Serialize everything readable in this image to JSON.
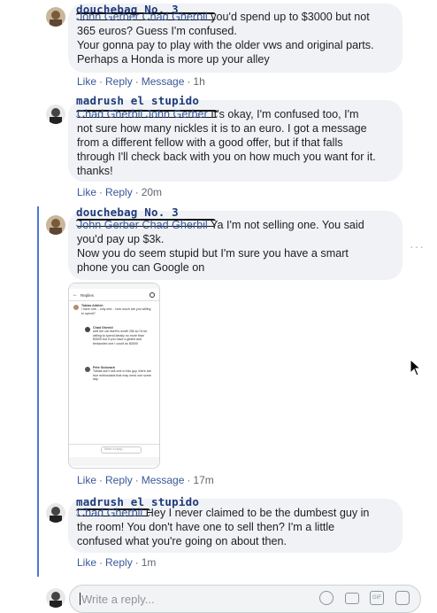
{
  "comments": [
    {
      "display_name": "douchebag No. 3",
      "names": [
        "John Gerber",
        "Chad Gherbil"
      ],
      "lines": [
        "you'd spend up to $3000 but not",
        "365 euros? Guess I'm confused.",
        "Your gonna pay to play with the older vws and original parts.",
        "Perhaps a Honda is more up your alley"
      ],
      "actions": [
        "Like",
        "Reply",
        "Message"
      ],
      "time": "1h"
    },
    {
      "display_name": "madrush el stupido",
      "names": [
        "Chad Gherbil",
        "John Gerber"
      ],
      "lines": [
        "It's okay, I'm confused too, I'm",
        "not sure how many nickles it is to an euro. I got a message",
        "from a different fellow with a good offer, but if that falls",
        "through I'll check back with you on how much you want for it.",
        "thanks!"
      ],
      "actions": [
        "Like",
        "Reply"
      ],
      "time": "20m"
    },
    {
      "display_name": "douchebag No. 3",
      "names": [
        "John Gerber",
        "Chad Gherbil"
      ],
      "lines": [
        "Ya I'm not selling one. You said",
        "you'd pay up $3k.",
        "Now you do seem stupid but I'm sure you have a smart",
        "phone you can Google on"
      ],
      "actions": [
        "Like",
        "Reply",
        "Message"
      ],
      "time": "17m"
    },
    {
      "display_name": "madrush el stupido",
      "names": [
        "Chad Gherbil"
      ],
      "lines": [
        "Hey I never claimed to be the dumbest guy in",
        "the room! You don't have one to sell then? I'm a little",
        "confused what you're going on about then."
      ],
      "actions": [
        "Like",
        "Reply"
      ],
      "time": "1m"
    }
  ],
  "attached_screenshot": {
    "header": "Replies",
    "items": [
      {
        "name": "Tobias Aldrich",
        "text": "I have one... only one... how much are you willing to spend?"
      },
      {
        "name": "Chad Gherbil",
        "text": "well the car itself is worth 25k so I'd be willing to spend ideally no more than $3000 but if you have a gilded and bedazzled one I could do $4000"
      },
      {
        "name": "Pete Golovach",
        "text": "Tobias don't sell one to this guy, there are true enthusiasts that may need one some day"
      }
    ],
    "reply_placeholder": "Write a reply..."
  },
  "composer": {
    "placeholder": "Write a reply..."
  },
  "icons": [
    "emoji-icon",
    "camera-icon",
    "gif-icon",
    "sticker-icon"
  ]
}
